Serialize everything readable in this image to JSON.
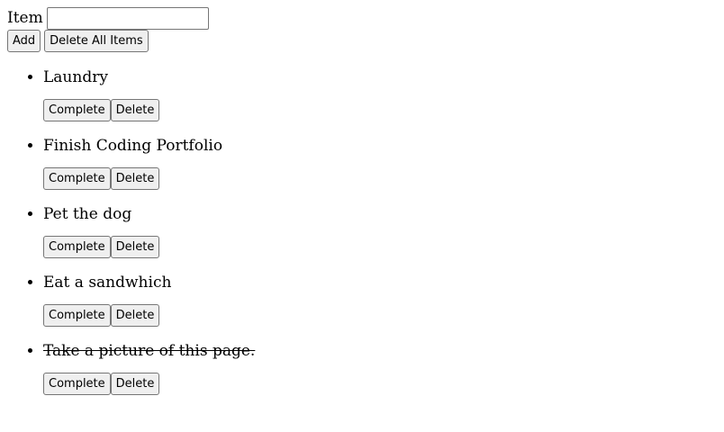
{
  "form": {
    "item_label": "Item",
    "item_value": "",
    "add_label": "Add",
    "delete_all_label": "Delete All Items"
  },
  "todos": [
    {
      "text": "Laundry",
      "completed": false,
      "complete_label": "Complete",
      "delete_label": "Delete"
    },
    {
      "text": "Finish Coding Portfolio",
      "completed": false,
      "complete_label": "Complete",
      "delete_label": "Delete"
    },
    {
      "text": "Pet the dog",
      "completed": false,
      "complete_label": "Complete",
      "delete_label": "Delete"
    },
    {
      "text": "Eat a sandwhich",
      "completed": false,
      "complete_label": "Complete",
      "delete_label": "Delete"
    },
    {
      "text": "Take a picture of this page.",
      "completed": true,
      "complete_label": "Complete",
      "delete_label": "Delete"
    }
  ]
}
